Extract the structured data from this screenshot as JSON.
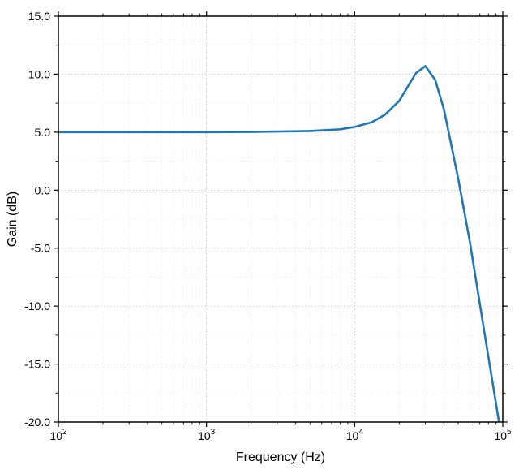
{
  "chart_data": {
    "type": "line",
    "title": "",
    "xlabel": "Frequency (Hz)",
    "ylabel": "Gain (dB)",
    "x_scale": "log",
    "xlim": [
      100,
      100000
    ],
    "ylim": [
      -20,
      15
    ],
    "x_ticks_major": [
      100,
      1000,
      10000,
      100000
    ],
    "x_tick_labels": [
      "10^2",
      "10^3",
      "10^4",
      "10^5"
    ],
    "y_ticks_major": [
      -20,
      -15,
      -10,
      -5,
      0,
      5,
      10,
      15
    ],
    "y_tick_labels": [
      "-20.0",
      "-15.0",
      "-10.0",
      "-5.0",
      "0.0",
      "5.0",
      "10.0",
      "15.0"
    ],
    "y_ticks_minor": [
      -17.5,
      -12.5,
      -7.5,
      -2.5,
      2.5,
      7.5,
      12.5
    ],
    "grid": true,
    "series": [
      {
        "name": "gain",
        "color": "#1f77b4",
        "x": [
          100,
          200,
          500,
          1000,
          2000,
          5000,
          8000,
          10000,
          13000,
          16000,
          20000,
          23000,
          26000,
          30000,
          35000,
          40000,
          50000,
          60000,
          75000,
          100000
        ],
        "y": [
          5.0,
          5.0,
          5.0,
          5.0,
          5.02,
          5.1,
          5.25,
          5.45,
          5.85,
          6.5,
          7.7,
          9.0,
          10.1,
          10.7,
          9.5,
          7.0,
          1.0,
          -4.5,
          -12.2,
          -22.0
        ]
      }
    ]
  },
  "colors": {
    "line": "#1f77b4",
    "frame": "#000000",
    "grid_major": "#bfbfbf",
    "grid_minor": "#d7d7d7"
  }
}
